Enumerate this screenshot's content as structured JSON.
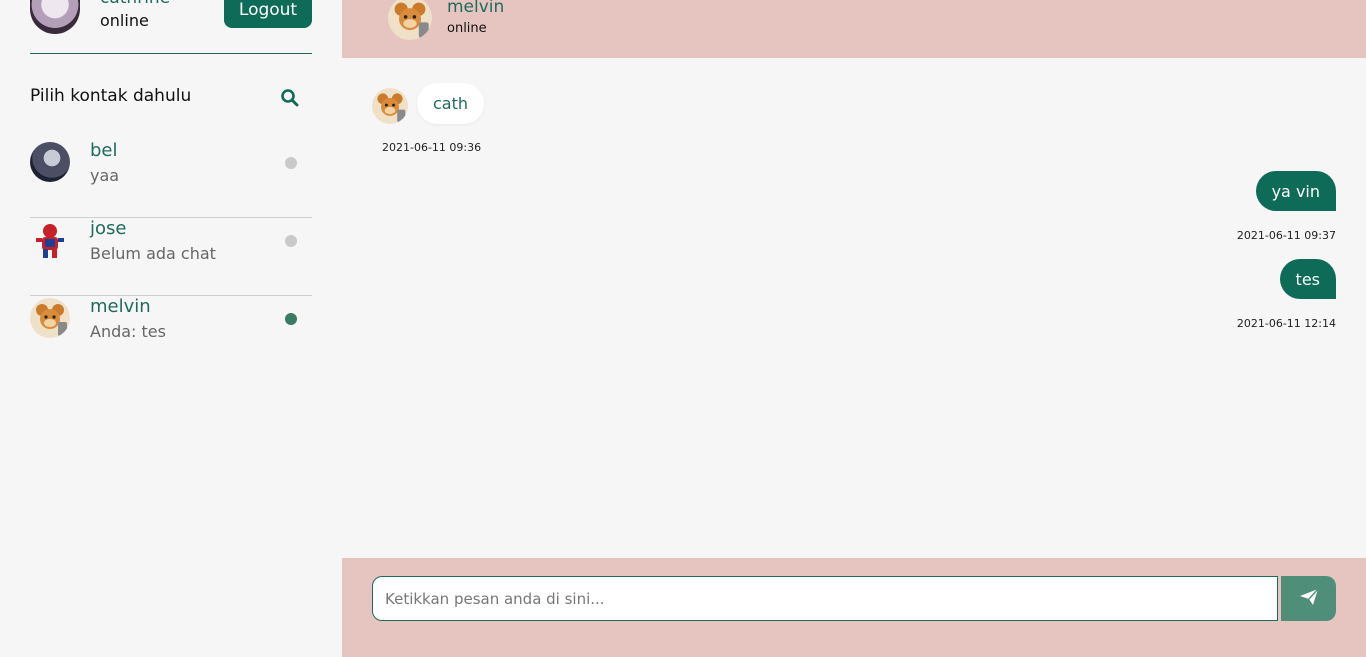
{
  "me": {
    "name": "cathrine",
    "status": "online",
    "logout_label": "Logout"
  },
  "contacts_panel": {
    "title": "Pilih kontak dahulu"
  },
  "contacts": [
    {
      "name": "bel",
      "preview": "yaa",
      "online": false
    },
    {
      "name": "jose",
      "preview": "Belum ada chat",
      "online": false
    },
    {
      "name": "melvin",
      "preview": "Anda: tes",
      "online": true
    }
  ],
  "chat": {
    "contact_name": "melvin",
    "contact_status": "online",
    "messages": [
      {
        "direction": "incoming",
        "text": "cath",
        "time": "2021-06-11 09:36"
      },
      {
        "direction": "outgoing",
        "text": "ya vin",
        "time": "2021-06-11 09:37"
      },
      {
        "direction": "outgoing",
        "text": "tes",
        "time": "2021-06-11 12:14"
      }
    ],
    "input_placeholder": "Ketikkan pesan anda di sini..."
  },
  "colors": {
    "primary": "#0e6b58",
    "header_bg": "#e6c4c0",
    "page_bg": "#f6f6f6",
    "online_dot": "#3b7a63",
    "offline_dot": "#c9c9c9"
  },
  "icons": {
    "search": "search-icon",
    "send": "send-icon"
  }
}
